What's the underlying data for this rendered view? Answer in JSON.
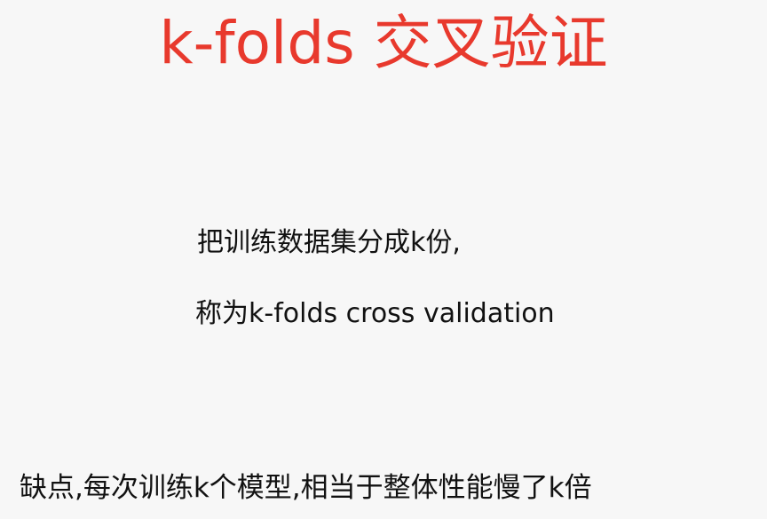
{
  "slide": {
    "title": "k-folds 交叉验证",
    "line1": "把训练数据集分成k份,",
    "line2": "称为k-folds cross validation",
    "line3": "缺点,每次训练k个模型,相当于整体性能慢了k倍"
  },
  "colors": {
    "title": "#e8392d",
    "body_text": "#111111",
    "background": "#f7f7f7"
  }
}
